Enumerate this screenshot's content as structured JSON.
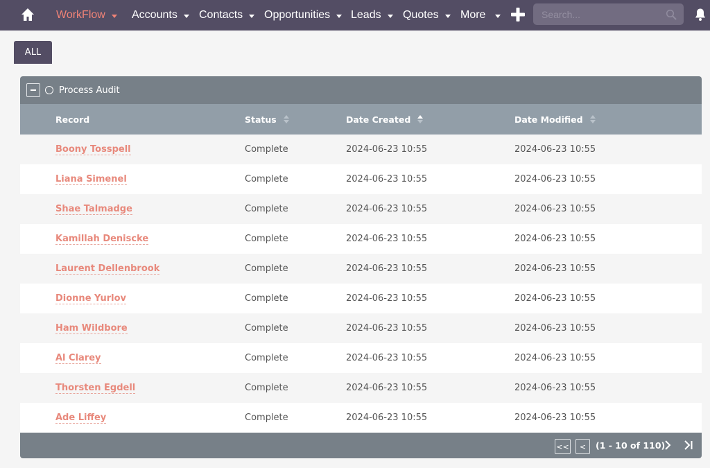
{
  "navbar": {
    "home_icon": "home-icon",
    "items": [
      {
        "label": "WorkFlow",
        "active": true
      },
      {
        "label": "Accounts",
        "active": false
      },
      {
        "label": "Contacts",
        "active": false
      },
      {
        "label": "Opportunities",
        "active": false
      },
      {
        "label": "Leads",
        "active": false
      },
      {
        "label": "Quotes",
        "active": false
      },
      {
        "label": "More",
        "active": false
      }
    ],
    "create_icon": "plus-icon",
    "search_placeholder": "Search...",
    "search_value": "",
    "notifications_icon": "bell-icon"
  },
  "tabs": [
    {
      "label": "ALL",
      "active": true
    }
  ],
  "panel": {
    "title": "Process Audit",
    "collapse_icon": "minus-icon",
    "title_icon": "circle-icon",
    "columns": [
      {
        "label": "Record",
        "sortable": false
      },
      {
        "label": "Status",
        "sortable": true,
        "sort": "none"
      },
      {
        "label": "Date Created",
        "sortable": true,
        "sort": "asc"
      },
      {
        "label": "Date Modified",
        "sortable": true,
        "sort": "none"
      }
    ],
    "rows": [
      {
        "record": "Boony Tosspell",
        "status": "Complete",
        "date_created": "2024-06-23 10:55",
        "date_modified": "2024-06-23 10:55"
      },
      {
        "record": "Liana Simenel",
        "status": "Complete",
        "date_created": "2024-06-23 10:55",
        "date_modified": "2024-06-23 10:55"
      },
      {
        "record": "Shae Talmadge",
        "status": "Complete",
        "date_created": "2024-06-23 10:55",
        "date_modified": "2024-06-23 10:55"
      },
      {
        "record": "Kamillah Deniscke",
        "status": "Complete",
        "date_created": "2024-06-23 10:55",
        "date_modified": "2024-06-23 10:55"
      },
      {
        "record": "Laurent Dellenbrook",
        "status": "Complete",
        "date_created": "2024-06-23 10:55",
        "date_modified": "2024-06-23 10:55"
      },
      {
        "record": "Dionne Yurlov",
        "status": "Complete",
        "date_created": "2024-06-23 10:55",
        "date_modified": "2024-06-23 10:55"
      },
      {
        "record": "Ham Wildbore",
        "status": "Complete",
        "date_created": "2024-06-23 10:55",
        "date_modified": "2024-06-23 10:55"
      },
      {
        "record": "Al Clarey",
        "status": "Complete",
        "date_created": "2024-06-23 10:55",
        "date_modified": "2024-06-23 10:55"
      },
      {
        "record": "Thorsten Egdell",
        "status": "Complete",
        "date_created": "2024-06-23 10:55",
        "date_modified": "2024-06-23 10:55"
      },
      {
        "record": "Ade Liffey",
        "status": "Complete",
        "date_created": "2024-06-23 10:55",
        "date_modified": "2024-06-23 10:55"
      }
    ],
    "pagination": {
      "first_label": "<<",
      "prev_label": "<",
      "range_text": "(1 - 10 of 110)",
      "next_icon": "chevron-right-icon",
      "last_icon": "last-page-icon"
    }
  },
  "colors": {
    "navbar_bg": "#534d64",
    "accent": "#f08377",
    "link": "#e8897c",
    "panel_header_bg": "#778088",
    "table_head_bg": "#929ea8"
  }
}
